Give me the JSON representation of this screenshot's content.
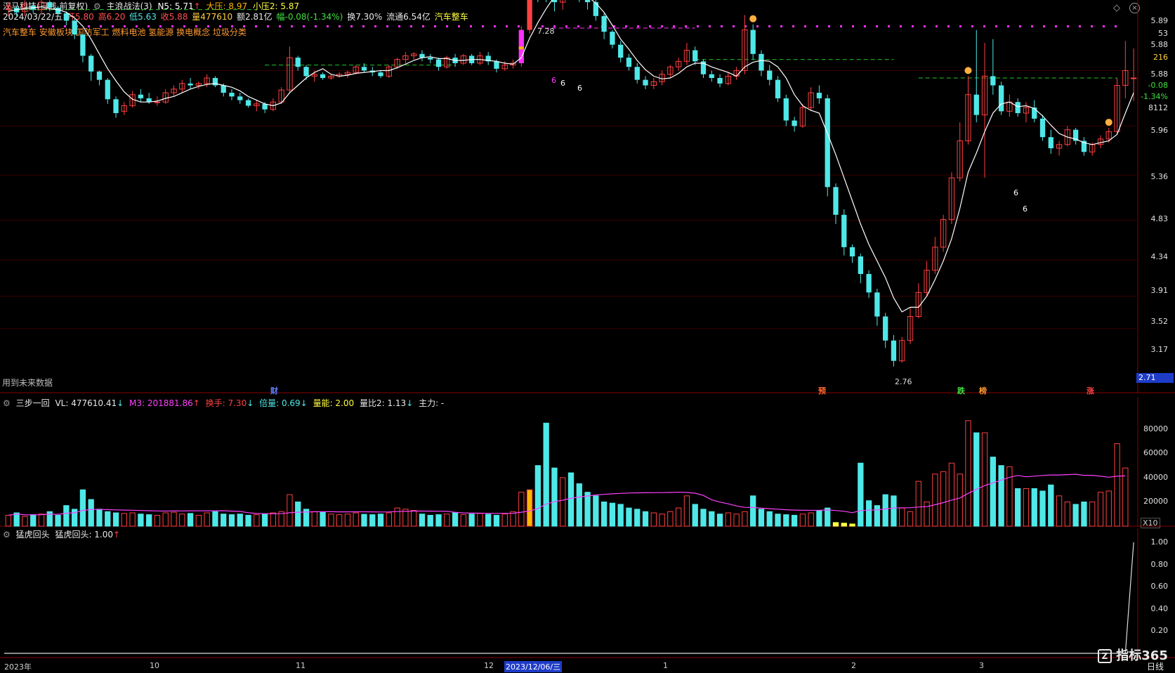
{
  "colors": {
    "up": "#ff4040",
    "down": "#4fe8e8",
    "ma": "#ffffff",
    "gridline": "#8b0000",
    "dashed": "#28c828",
    "dots": "#ff30ff",
    "orange": "#ffb400",
    "vol_ma": "#ff40ff"
  },
  "header": {
    "title": "汉马科技(日线 前复权)",
    "indicator": "主浪战法(3)",
    "n5": "N5: 5.71",
    "n5_arrow": "↑",
    "dayaya": "大压: 8.97",
    "xiaoya": "小压2: 5.87",
    "date": "2024/03/22/五",
    "open": "开5.80",
    "high": "高6.20",
    "low": "低5.63",
    "close": "收5.88",
    "volume": "量477610",
    "amount": "额2.81亿",
    "change": "幅-0.08(-1.34%)",
    "turnover": "换7.30%",
    "float": "流通6.54亿",
    "sector": "汽车整车"
  },
  "concepts": "汽车整车 安徽板块 国防军工 燃料电池 氢能源 换电概念 垃圾分类",
  "future_data": "用到未来数据",
  "main_panel": {
    "price_axis": [
      "5.89",
      "53",
      "5.88",
      "216",
      "5.88",
      "-0.08",
      "-1.34%",
      "8112",
      "5.96",
      "5.36",
      "4.83",
      "4.34",
      "3.91",
      "3.52",
      "3.17"
    ],
    "current_price": "2.71",
    "high_label": "7.28",
    "low_label": "2.76",
    "six_labels": [
      "6",
      "6",
      "6",
      "6",
      "6"
    ],
    "markers": [
      "财",
      "预",
      "跌",
      "榜",
      "涨"
    ]
  },
  "vol_panel": {
    "title": "三步一回",
    "vl": "VL: 477610.41",
    "vl_arrow": "↓",
    "m3": "M3: 201881.86",
    "m3_arrow": "↑",
    "huanshou": "换手: 7.30",
    "huanshou_arrow": "↓",
    "beiliang": "倍量: 0.69",
    "beiliang_arrow": "↓",
    "liangneng": "量能: 2.00",
    "liangbi": "量比2: 1.13",
    "liangbi_arrow": "↓",
    "zhuli": "主力: -",
    "axis": [
      "80000",
      "60000",
      "40000",
      "20000"
    ],
    "unit": "X10"
  },
  "ind_panel": {
    "title": "猛虎回头",
    "value": "猛虎回头: 1.00",
    "arrow": "↑",
    "axis": [
      "1.00",
      "0.80",
      "0.60",
      "0.40",
      "0.20"
    ]
  },
  "date_axis": [
    "2023年",
    "10",
    "11",
    "12",
    "2023/12/06/三",
    "1",
    "2",
    "3"
  ],
  "period": "日线",
  "watermark": "指标365",
  "chart_data": {
    "type": "candlestick",
    "ohlc": [
      [
        6.62,
        6.7,
        6.55,
        6.66
      ],
      [
        6.64,
        6.66,
        6.55,
        6.59
      ],
      [
        6.6,
        6.72,
        6.55,
        6.68
      ],
      [
        6.66,
        6.7,
        6.58,
        6.62
      ],
      [
        6.62,
        6.74,
        6.58,
        6.7
      ],
      [
        6.7,
        6.72,
        6.6,
        6.64
      ],
      [
        6.64,
        6.66,
        6.55,
        6.58
      ],
      [
        6.58,
        6.6,
        6.45,
        6.5
      ],
      [
        6.5,
        6.52,
        6.3,
        6.35
      ],
      [
        6.35,
        6.36,
        6.05,
        6.12
      ],
      [
        6.12,
        6.14,
        5.85,
        5.95
      ],
      [
        5.95,
        5.96,
        5.8,
        5.86
      ],
      [
        5.86,
        5.88,
        5.6,
        5.65
      ],
      [
        5.65,
        5.68,
        5.45,
        5.5
      ],
      [
        5.52,
        5.62,
        5.48,
        5.58
      ],
      [
        5.58,
        5.74,
        5.56,
        5.7
      ],
      [
        5.7,
        5.76,
        5.62,
        5.66
      ],
      [
        5.66,
        5.72,
        5.6,
        5.62
      ],
      [
        5.62,
        5.68,
        5.58,
        5.62
      ],
      [
        5.62,
        5.76,
        5.6,
        5.72
      ],
      [
        5.72,
        5.8,
        5.68,
        5.76
      ],
      [
        5.76,
        5.86,
        5.72,
        5.82
      ],
      [
        5.82,
        5.88,
        5.76,
        5.8
      ],
      [
        5.8,
        5.84,
        5.76,
        5.82
      ],
      [
        5.82,
        5.92,
        5.78,
        5.88
      ],
      [
        5.88,
        5.9,
        5.78,
        5.8
      ],
      [
        5.8,
        5.82,
        5.68,
        5.72
      ],
      [
        5.72,
        5.76,
        5.64,
        5.68
      ],
      [
        5.68,
        5.72,
        5.6,
        5.64
      ],
      [
        5.64,
        5.66,
        5.56,
        5.58
      ],
      [
        5.58,
        5.64,
        5.52,
        5.6
      ],
      [
        5.6,
        5.62,
        5.5,
        5.54
      ],
      [
        5.54,
        5.66,
        5.52,
        5.62
      ],
      [
        5.62,
        5.78,
        5.6,
        5.75
      ],
      [
        5.75,
        6.22,
        5.72,
        6.1
      ],
      [
        6.1,
        6.12,
        5.96,
        6.0
      ],
      [
        6.0,
        6.02,
        5.86,
        5.9
      ],
      [
        5.9,
        5.96,
        5.84,
        5.92
      ],
      [
        5.92,
        5.94,
        5.86,
        5.88
      ],
      [
        5.88,
        5.92,
        5.86,
        5.9
      ],
      [
        5.9,
        5.94,
        5.88,
        5.92
      ],
      [
        5.92,
        5.96,
        5.88,
        5.94
      ],
      [
        5.94,
        6.02,
        5.92,
        6.0
      ],
      [
        6.0,
        6.04,
        5.94,
        5.96
      ],
      [
        5.96,
        6.0,
        5.9,
        5.94
      ],
      [
        5.94,
        5.96,
        5.88,
        5.9
      ],
      [
        5.9,
        6.02,
        5.88,
        6.0
      ],
      [
        6.0,
        6.1,
        5.98,
        6.08
      ],
      [
        6.08,
        6.16,
        6.04,
        6.12
      ],
      [
        6.12,
        6.16,
        6.08,
        6.14
      ],
      [
        6.14,
        6.18,
        6.06,
        6.1
      ],
      [
        6.1,
        6.14,
        6.04,
        6.08
      ],
      [
        6.08,
        6.1,
        5.96,
        6.0
      ],
      [
        6.0,
        6.12,
        5.98,
        6.1
      ],
      [
        6.1,
        6.14,
        6.0,
        6.04
      ],
      [
        6.04,
        6.14,
        6.02,
        6.12
      ],
      [
        6.12,
        6.14,
        6.02,
        6.04
      ],
      [
        6.04,
        6.16,
        6.02,
        6.12
      ],
      [
        6.12,
        6.16,
        6.02,
        6.06
      ],
      [
        6.06,
        6.08,
        5.94,
        5.98
      ],
      [
        5.98,
        6.06,
        5.96,
        6.02
      ],
      [
        6.02,
        6.08,
        5.98,
        6.04
      ],
      [
        6.04,
        6.44,
        6.0,
        6.4
      ],
      [
        6.4,
        7.28,
        6.36,
        7.2
      ],
      [
        7.2,
        7.3,
        6.7,
        6.8
      ],
      [
        6.8,
        6.86,
        6.7,
        6.76
      ],
      [
        6.76,
        6.84,
        6.6,
        6.7
      ],
      [
        6.7,
        7.0,
        6.62,
        6.92
      ],
      [
        6.92,
        6.98,
        6.78,
        6.84
      ],
      [
        6.84,
        6.88,
        6.7,
        6.76
      ],
      [
        6.76,
        6.8,
        6.62,
        6.7
      ],
      [
        6.7,
        6.74,
        6.5,
        6.55
      ],
      [
        6.55,
        6.58,
        6.3,
        6.38
      ],
      [
        6.38,
        6.4,
        6.2,
        6.24
      ],
      [
        6.24,
        6.28,
        6.05,
        6.1
      ],
      [
        6.1,
        6.14,
        5.96,
        6.0
      ],
      [
        6.0,
        6.04,
        5.82,
        5.86
      ],
      [
        5.86,
        5.9,
        5.76,
        5.8
      ],
      [
        5.8,
        5.88,
        5.76,
        5.84
      ],
      [
        5.84,
        5.96,
        5.8,
        5.92
      ],
      [
        5.92,
        6.02,
        5.88,
        6.0
      ],
      [
        6.0,
        6.1,
        5.96,
        6.06
      ],
      [
        6.06,
        6.26,
        6.02,
        6.18
      ],
      [
        6.18,
        6.22,
        6.02,
        6.06
      ],
      [
        6.06,
        6.08,
        5.88,
        5.92
      ],
      [
        5.92,
        5.96,
        5.84,
        5.88
      ],
      [
        5.88,
        5.92,
        5.78,
        5.82
      ],
      [
        5.82,
        5.94,
        5.8,
        5.9
      ],
      [
        5.9,
        6.0,
        5.86,
        5.96
      ],
      [
        5.96,
        6.56,
        5.92,
        6.4
      ],
      [
        6.4,
        6.46,
        6.08,
        6.14
      ],
      [
        6.14,
        6.18,
        5.9,
        5.96
      ],
      [
        5.96,
        6.02,
        5.8,
        5.86
      ],
      [
        5.86,
        5.9,
        5.62,
        5.66
      ],
      [
        5.66,
        5.7,
        5.36,
        5.42
      ],
      [
        5.42,
        5.46,
        5.3,
        5.36
      ],
      [
        5.36,
        5.6,
        5.34,
        5.56
      ],
      [
        5.56,
        5.78,
        5.52,
        5.72
      ],
      [
        5.72,
        5.8,
        5.6,
        5.66
      ],
      [
        5.66,
        5.7,
        4.6,
        4.7
      ],
      [
        4.7,
        4.74,
        4.3,
        4.4
      ],
      [
        4.4,
        4.46,
        3.96,
        4.05
      ],
      [
        4.05,
        4.08,
        3.88,
        3.95
      ],
      [
        3.95,
        3.98,
        3.66,
        3.76
      ],
      [
        3.76,
        3.8,
        3.5,
        3.56
      ],
      [
        3.56,
        3.6,
        3.2,
        3.3
      ],
      [
        3.3,
        3.34,
        2.96,
        3.04
      ],
      [
        3.04,
        3.1,
        2.76,
        2.82
      ],
      [
        2.82,
        3.08,
        2.8,
        3.04
      ],
      [
        3.04,
        3.4,
        3.0,
        3.3
      ],
      [
        3.3,
        3.66,
        3.28,
        3.56
      ],
      [
        3.56,
        3.9,
        3.52,
        3.8
      ],
      [
        3.8,
        4.16,
        3.76,
        4.05
      ],
      [
        4.05,
        4.4,
        4.0,
        4.35
      ],
      [
        4.35,
        4.86,
        4.3,
        4.8
      ],
      [
        4.8,
        5.4,
        4.76,
        5.2
      ],
      [
        5.2,
        5.9,
        5.16,
        5.7
      ],
      [
        5.7,
        6.4,
        5.4,
        5.48
      ],
      [
        5.48,
        6.26,
        4.8,
        5.9
      ],
      [
        5.9,
        6.3,
        5.7,
        5.8
      ],
      [
        5.8,
        5.84,
        5.48,
        5.52
      ],
      [
        5.52,
        5.7,
        5.46,
        5.62
      ],
      [
        5.62,
        5.66,
        5.46,
        5.5
      ],
      [
        5.5,
        5.62,
        5.4,
        5.56
      ],
      [
        5.56,
        5.64,
        5.4,
        5.44
      ],
      [
        5.44,
        5.48,
        5.2,
        5.24
      ],
      [
        5.24,
        5.32,
        5.06,
        5.12
      ],
      [
        5.12,
        5.2,
        5.04,
        5.16
      ],
      [
        5.16,
        5.36,
        5.14,
        5.32
      ],
      [
        5.32,
        5.34,
        5.16,
        5.2
      ],
      [
        5.2,
        5.24,
        5.04,
        5.08
      ],
      [
        5.08,
        5.18,
        5.04,
        5.16
      ],
      [
        5.16,
        5.26,
        5.12,
        5.22
      ],
      [
        5.22,
        5.34,
        5.18,
        5.3
      ],
      [
        5.3,
        5.88,
        5.28,
        5.8
      ],
      [
        5.8,
        6.28,
        5.66,
        5.96
      ],
      [
        5.88,
        6.2,
        5.63,
        5.88
      ]
    ],
    "volume": [
      9000,
      11000,
      8000,
      9500,
      10000,
      12000,
      9000,
      17000,
      14000,
      30000,
      22000,
      14000,
      12000,
      11000,
      10500,
      11000,
      10000,
      9500,
      9000,
      11000,
      11500,
      10000,
      10500,
      9000,
      11000,
      12000,
      10000,
      9500,
      10000,
      9000,
      9500,
      10000,
      11000,
      12000,
      26000,
      20000,
      14000,
      12000,
      11500,
      10000,
      9500,
      10000,
      11000,
      9800,
      9500,
      10000,
      11000,
      15000,
      14000,
      13000,
      10000,
      9000,
      9500,
      10000,
      11000,
      9500,
      10000,
      10500,
      9800,
      9000,
      10000,
      12000,
      28000,
      30000,
      50000,
      85000,
      48000,
      40000,
      44000,
      35000,
      28000,
      25000,
      20000,
      19000,
      18000,
      15000,
      14000,
      12000,
      11000,
      10000,
      12000,
      15000,
      25000,
      18000,
      14000,
      12000,
      10000,
      11000,
      10000,
      12000,
      25000,
      14000,
      12000,
      10000,
      9500,
      9000,
      10000,
      11000,
      13000,
      15000,
      3000,
      2500,
      1800,
      52000,
      21000,
      17000,
      26000,
      25000,
      15000,
      12000,
      37000,
      20000,
      43000,
      45000,
      52000,
      43000,
      87000,
      77000,
      77000,
      57000,
      50000,
      49000,
      31000,
      31000,
      31000,
      29000,
      34000,
      25000,
      20000,
      18000,
      20000,
      20000,
      28000,
      29000,
      68000,
      48000
    ],
    "ma5": [
      6.6,
      6.62,
      6.63,
      6.64,
      6.65,
      6.63,
      6.62,
      6.59,
      6.53,
      6.44,
      6.3,
      6.14,
      5.98,
      5.85,
      5.73,
      5.65,
      5.62,
      5.62,
      5.63,
      5.66,
      5.68,
      5.72,
      5.76,
      5.79,
      5.81,
      5.82,
      5.8,
      5.78,
      5.74,
      5.68,
      5.64,
      5.6,
      5.58,
      5.61,
      5.72,
      5.8,
      5.88,
      5.94,
      5.98,
      5.92,
      5.9,
      5.91,
      5.93,
      5.94,
      5.95,
      5.96,
      5.96,
      5.99,
      6.03,
      6.07,
      6.1,
      6.11,
      6.09,
      6.09,
      6.07,
      6.07,
      6.08,
      6.08,
      6.07,
      6.06,
      6.04,
      6.03,
      6.1,
      6.31,
      6.48,
      6.63,
      6.76,
      6.83,
      6.84,
      6.8,
      6.76,
      6.69,
      6.59,
      6.45,
      6.3,
      6.19,
      6.07,
      5.97,
      5.9,
      5.87,
      5.88,
      5.93,
      6.0,
      6.04,
      6.04,
      6.0,
      5.97,
      5.94,
      5.9,
      6.0,
      6.05,
      6.07,
      6.06,
      6.0,
      5.88,
      5.7,
      5.58,
      5.53,
      5.5,
      5.28,
      5.05,
      4.8,
      4.55,
      4.3,
      4.08,
      3.9,
      3.72,
      3.5,
      3.35,
      3.4,
      3.4,
      3.52,
      3.7,
      3.9,
      4.14,
      4.47,
      4.86,
      5.07,
      5.3,
      5.5,
      5.6,
      5.62,
      5.57,
      5.58,
      5.55,
      5.47,
      5.37,
      5.28,
      5.24,
      5.22,
      5.18,
      5.16,
      5.18,
      5.2,
      5.27,
      5.5,
      5.72
    ]
  }
}
